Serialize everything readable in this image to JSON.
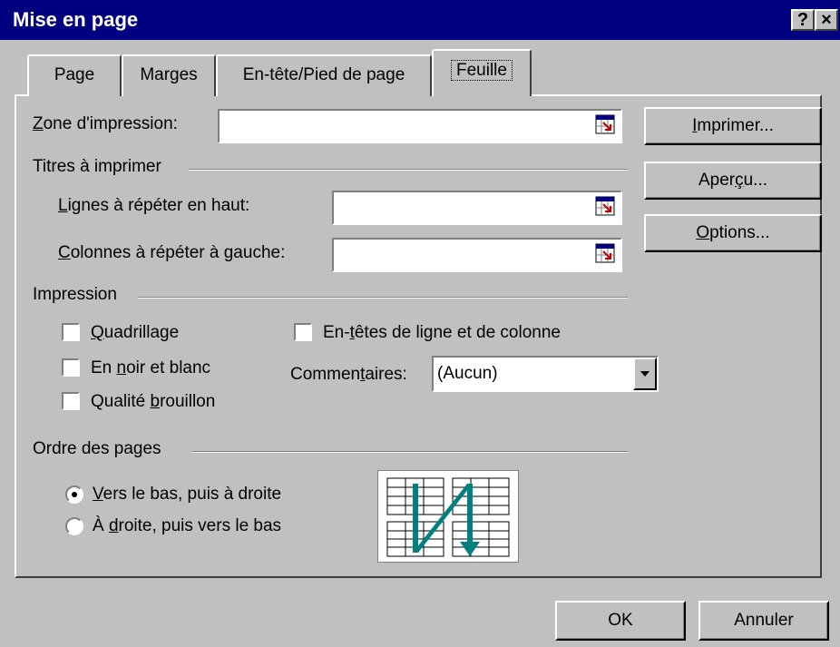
{
  "window": {
    "title": "Mise en page",
    "help_label": "?",
    "close_label": "×"
  },
  "tabs": [
    {
      "label": "Page",
      "active": false
    },
    {
      "label": "Marges",
      "active": false
    },
    {
      "label": "En-tête/Pied de page",
      "active": false
    },
    {
      "label": "Feuille",
      "active": true
    }
  ],
  "print_area": {
    "label_underline": "Z",
    "label_rest": "one d'impression:",
    "value": ""
  },
  "print_titles": {
    "group_label": "Titres à imprimer",
    "rows_label_underline": "L",
    "rows_label_rest": "ignes à répéter en haut:",
    "rows_value": "",
    "cols_label_underline": "C",
    "cols_label_rest": "olonnes à répéter à gauche:",
    "cols_value": ""
  },
  "impression": {
    "group_label": "Impression",
    "gridlines": {
      "pre": "",
      "ul": "Q",
      "post": "uadrillage",
      "checked": false
    },
    "black_white": {
      "pre": "En ",
      "ul": "n",
      "post": "oir et blanc",
      "checked": false
    },
    "draft": {
      "pre": "Qualité ",
      "ul": "b",
      "post": "rouillon",
      "checked": false
    },
    "headings": {
      "pre": "En-",
      "ul": "t",
      "post": "êtes de ligne et de colonne",
      "checked": false
    },
    "comments": {
      "pre": "Commen",
      "ul": "t",
      "post": "aires:",
      "value": "(Aucun)"
    }
  },
  "page_order": {
    "group_label": "Ordre des pages",
    "down_then_over": {
      "pre": "",
      "ul": "V",
      "post": "ers le bas, puis à droite",
      "selected": true
    },
    "over_then_down": {
      "pre": "À ",
      "ul": "d",
      "post": "roite, puis vers le bas",
      "selected": false
    }
  },
  "side_buttons": {
    "print": {
      "pre": "",
      "ul": "I",
      "post": "mprimer..."
    },
    "preview": {
      "pre": "Aper",
      "ul": "ç",
      "post": "u..."
    },
    "options": {
      "pre": "",
      "ul": "O",
      "post": "ptions..."
    }
  },
  "footer": {
    "ok_label": "OK",
    "cancel_label": "Annuler"
  },
  "colors": {
    "titlebar": "#000080",
    "face": "#c0c0c0",
    "arrow": "#008080"
  }
}
